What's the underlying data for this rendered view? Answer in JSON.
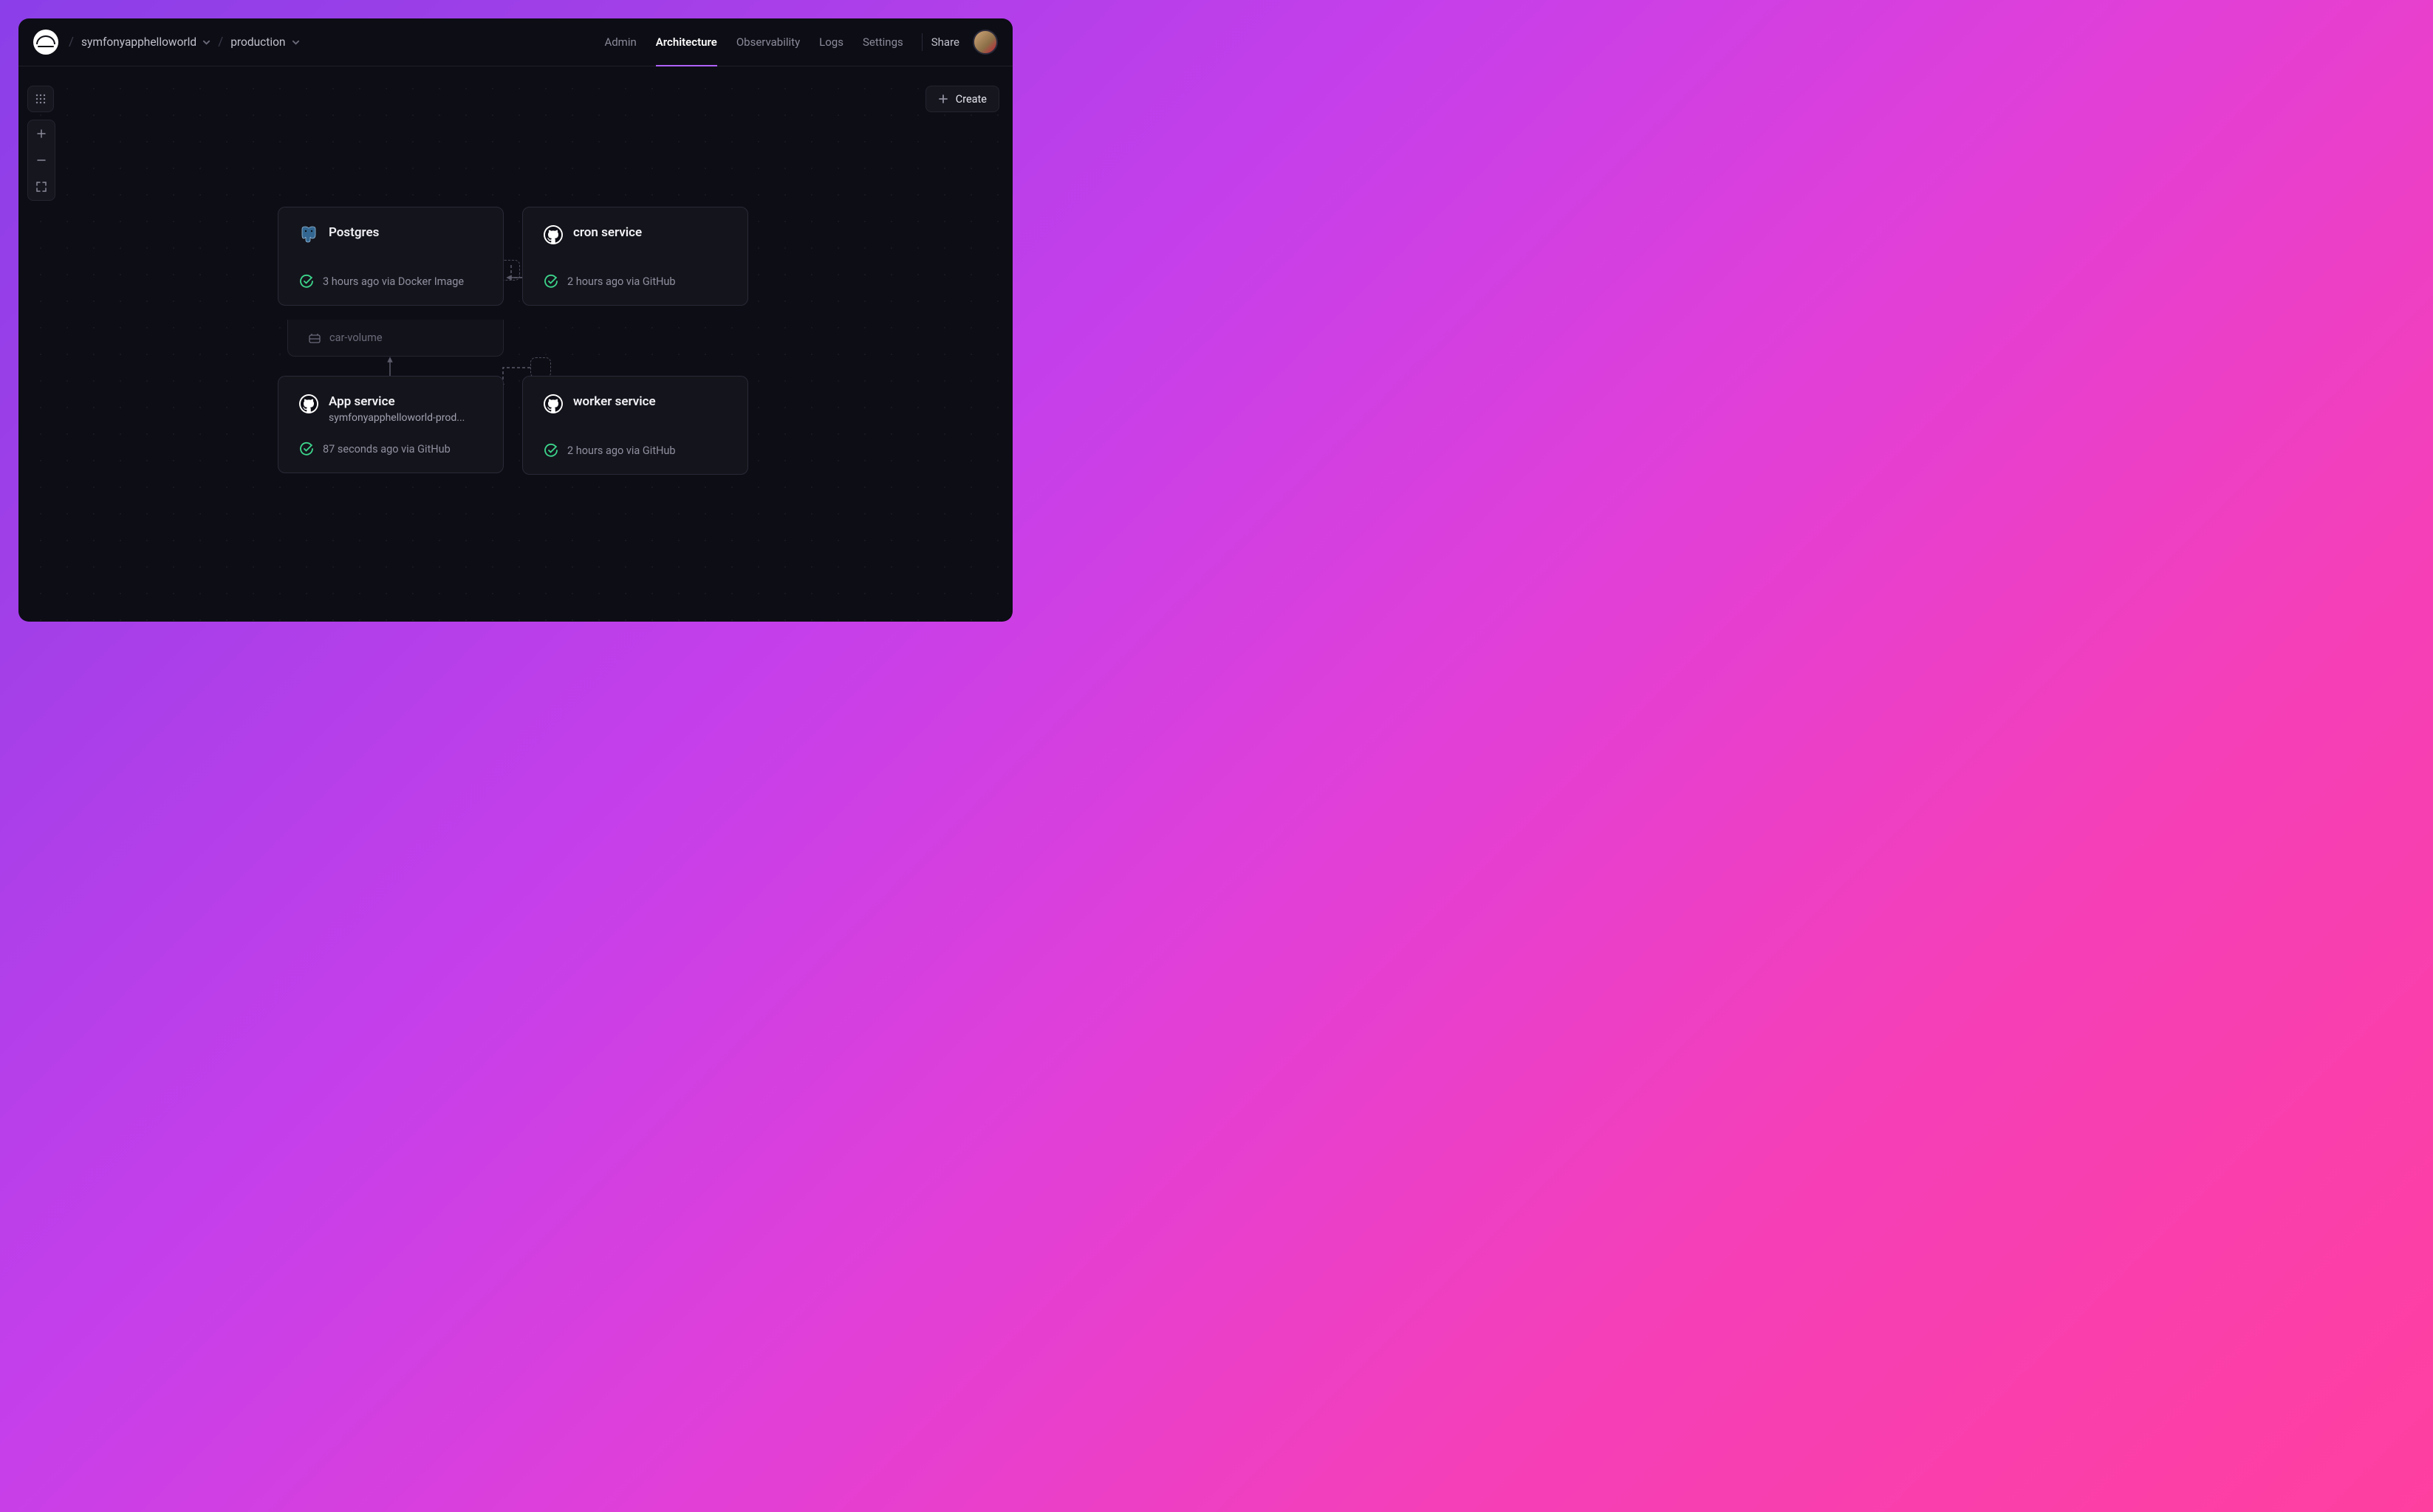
{
  "breadcrumb": {
    "project": "symfonyapphelloworld",
    "env": "production"
  },
  "nav": {
    "tabs": [
      {
        "label": "Admin",
        "active": false
      },
      {
        "label": "Architecture",
        "active": true
      },
      {
        "label": "Observability",
        "active": false
      },
      {
        "label": "Logs",
        "active": false
      },
      {
        "label": "Settings",
        "active": false
      }
    ],
    "share": "Share"
  },
  "actions": {
    "create": "Create"
  },
  "services": {
    "postgres": {
      "title": "Postgres",
      "status": "3 hours ago via Docker Image",
      "volume": "car-volume"
    },
    "cron": {
      "title": "cron service",
      "status": "2 hours ago via GitHub"
    },
    "app": {
      "title": "App service",
      "subtitle": "symfonyapphelloworld-prod...",
      "status": "87 seconds ago via GitHub"
    },
    "worker": {
      "title": "worker service",
      "status": "2 hours ago via GitHub"
    }
  },
  "colors": {
    "accent": "#b061ff",
    "success": "#3dd68c",
    "bg": "#0d0d15",
    "card": "#14141c",
    "border": "#2a2a38"
  }
}
